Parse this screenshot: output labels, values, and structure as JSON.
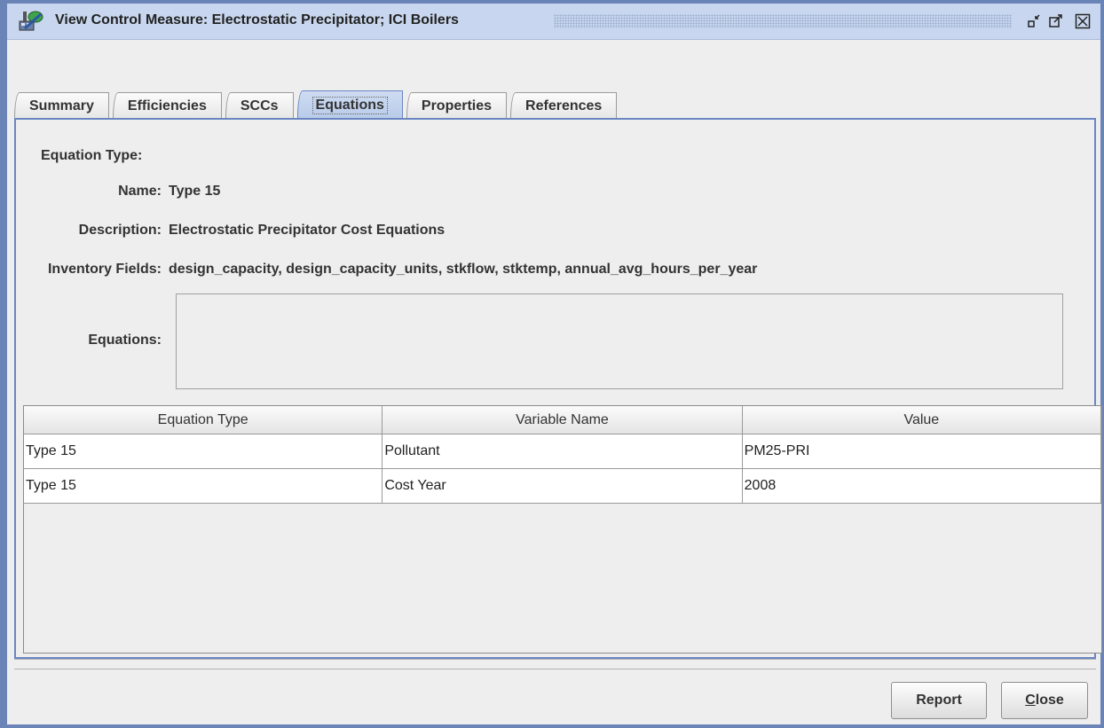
{
  "window": {
    "title": "View Control Measure: Electrostatic Precipitator; ICI Boilers"
  },
  "tabs": [
    {
      "label": "Summary"
    },
    {
      "label": "Efficiencies"
    },
    {
      "label": "SCCs"
    },
    {
      "label": "Equations",
      "selected": true
    },
    {
      "label": "Properties"
    },
    {
      "label": "References"
    }
  ],
  "form": {
    "equation_type_label": "Equation Type:",
    "name_label": "Name:",
    "name_value": "Type 15",
    "description_label": "Description:",
    "description_value": "Electrostatic Precipitator Cost Equations",
    "inventory_fields_label": "Inventory Fields:",
    "inventory_fields_value": "design_capacity, design_capacity_units, stkflow, stktemp, annual_avg_hours_per_year",
    "equations_label": "Equations:",
    "equations_value": ""
  },
  "table": {
    "headers": [
      "Equation Type",
      "Variable Name",
      "Value"
    ],
    "rows": [
      [
        "Type 15",
        "Pollutant",
        "PM25-PRI"
      ],
      [
        "Type 15",
        "Cost Year",
        "2008"
      ]
    ]
  },
  "buttons": {
    "report": "Report",
    "close_mnemonic": "C",
    "close_rest": "lose"
  },
  "colors": {
    "titlebar": "#c8d7ef",
    "accent_border": "#6a86c2",
    "selected_tab": "#b8cbe9"
  }
}
